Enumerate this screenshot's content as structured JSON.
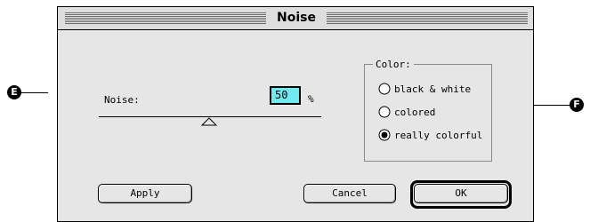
{
  "dialog": {
    "title": "Noise",
    "noise_label": "Noise:",
    "noise_value": "50",
    "percent_symbol": "%",
    "slider_level_percent": 50,
    "color_group": {
      "label": "Color:",
      "options": [
        {
          "label": "black & white",
          "selected": false
        },
        {
          "label": "colored",
          "selected": false
        },
        {
          "label": "really colorful",
          "selected": true
        }
      ]
    },
    "buttons": {
      "apply": "Apply",
      "cancel": "Cancel",
      "ok": "OK"
    },
    "input_highlight_color": "#6feaf0"
  },
  "callouts": {
    "left": "E",
    "right": "F"
  }
}
